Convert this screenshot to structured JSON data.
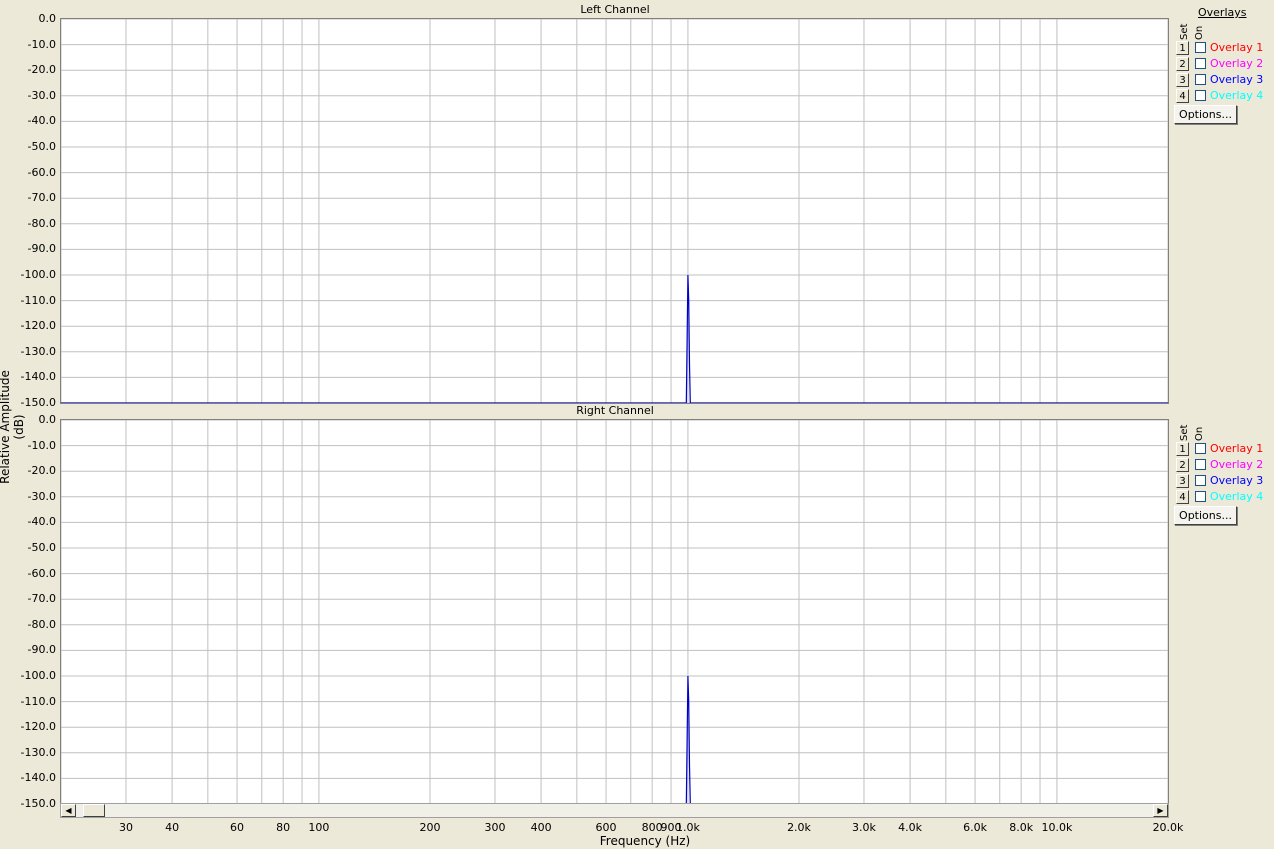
{
  "charts": [
    {
      "title": "Left Channel",
      "overlays_header": "Overlays",
      "set_label": "Set",
      "on_label": "On",
      "overlays": [
        {
          "set": "1",
          "label": "Overlay 1",
          "color": "#ff0000",
          "checked": false
        },
        {
          "set": "2",
          "label": "Overlay 2",
          "color": "#ff00ff",
          "checked": false
        },
        {
          "set": "3",
          "label": "Overlay 3",
          "color": "#0000ff",
          "checked": false
        },
        {
          "set": "4",
          "label": "Overlay 4",
          "color": "#00ffff",
          "checked": false
        }
      ],
      "options_label": "Options..."
    },
    {
      "title": "Right Channel",
      "set_label": "Set",
      "on_label": "On",
      "overlays": [
        {
          "set": "1",
          "label": "Overlay 1",
          "color": "#ff0000",
          "checked": false
        },
        {
          "set": "2",
          "label": "Overlay 2",
          "color": "#ff00ff",
          "checked": false
        },
        {
          "set": "3",
          "label": "Overlay 3",
          "color": "#0000ff",
          "checked": false
        },
        {
          "set": "4",
          "label": "Overlay 4",
          "color": "#00ffff",
          "checked": false
        }
      ],
      "options_label": "Options..."
    }
  ],
  "ylabel": "Relative Amplitude (dB)",
  "xlabel": "Frequency (Hz)",
  "y_ticks": [
    "0.0",
    "-10.0",
    "-20.0",
    "-30.0",
    "-40.0",
    "-50.0",
    "-60.0",
    "-70.0",
    "-80.0",
    "-90.0",
    "-100.0",
    "-110.0",
    "-120.0",
    "-130.0",
    "-140.0",
    "-150.0"
  ],
  "x_ticks": [
    {
      "v": 30,
      "label": "30"
    },
    {
      "v": 40,
      "label": "40"
    },
    {
      "v": 60,
      "label": "60"
    },
    {
      "v": 80,
      "label": "80"
    },
    {
      "v": 100,
      "label": "100"
    },
    {
      "v": 200,
      "label": "200"
    },
    {
      "v": 300,
      "label": "300"
    },
    {
      "v": 400,
      "label": "400"
    },
    {
      "v": 600,
      "label": "600"
    },
    {
      "v": 800,
      "label": "800"
    },
    {
      "v": 900,
      "label": "900"
    },
    {
      "v": 1000,
      "label": "1.0k"
    },
    {
      "v": 2000,
      "label": "2.0k"
    },
    {
      "v": 3000,
      "label": "3.0k"
    },
    {
      "v": 4000,
      "label": "4.0k"
    },
    {
      "v": 6000,
      "label": "6.0k"
    },
    {
      "v": 8000,
      "label": "8.0k"
    },
    {
      "v": 10000,
      "label": "10.0k"
    },
    {
      "v": 20000,
      "label": "20.0k"
    }
  ],
  "chart_data": [
    {
      "type": "line",
      "title": "Left Channel",
      "xlabel": "Frequency (Hz)",
      "ylabel": "Relative Amplitude (dB)",
      "x_scale": "log",
      "xlim": [
        20,
        20000
      ],
      "ylim": [
        -150,
        0
      ],
      "grid": true,
      "series": [
        {
          "color": "#0000cc",
          "x": [
            20,
            990,
            995,
            1000,
            1005,
            1010,
            1015,
            20000
          ],
          "y": [
            -150,
            -150,
            -125,
            -100,
            -110,
            -135,
            -150,
            -150
          ]
        }
      ]
    },
    {
      "type": "line",
      "title": "Right Channel",
      "xlabel": "Frequency (Hz)",
      "ylabel": "Relative Amplitude (dB)",
      "x_scale": "log",
      "xlim": [
        20,
        20000
      ],
      "ylim": [
        -150,
        0
      ],
      "grid": true,
      "series": [
        {
          "color": "#0000cc",
          "x": [
            20,
            990,
            995,
            1000,
            1005,
            1010,
            1015,
            20000
          ],
          "y": [
            -150,
            -150,
            -125,
            -100,
            -110,
            -135,
            -150,
            -150
          ]
        }
      ]
    }
  ]
}
